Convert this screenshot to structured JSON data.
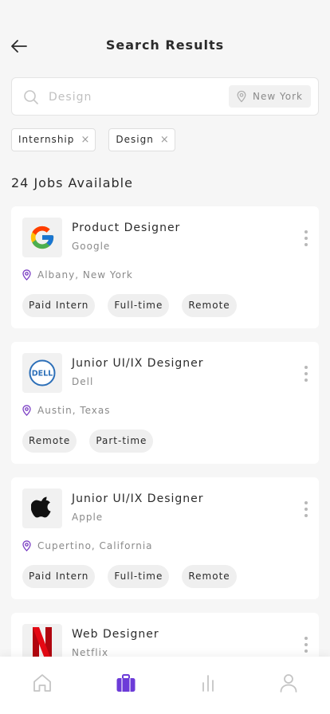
{
  "header": {
    "title": "Search Results"
  },
  "search": {
    "value": "",
    "placeholder": "Design",
    "location": "New York"
  },
  "filters": [
    {
      "label": "Internship"
    },
    {
      "label": "Design"
    }
  ],
  "results": {
    "count_label": "24 Jobs Available"
  },
  "jobs": [
    {
      "title": "Product Designer",
      "company": "Google",
      "location": "Albany, New York",
      "tags": [
        "Paid Intern",
        "Full-time",
        "Remote"
      ],
      "logo_icon": "google-logo-icon"
    },
    {
      "title": "Junior UI/IX Designer",
      "company": "Dell",
      "location": "Austin, Texas",
      "tags": [
        "Remote",
        "Part-time"
      ],
      "logo_icon": "dell-logo-icon",
      "logo_text": "DELL"
    },
    {
      "title": "Junior UI/IX Designer",
      "company": "Apple",
      "location": "Cupertino, California",
      "tags": [
        "Paid Intern",
        "Full-time",
        "Remote"
      ],
      "logo_icon": "apple-logo-icon"
    },
    {
      "title": "Web Designer",
      "company": "Netflix",
      "location": "",
      "tags": [],
      "logo_icon": "netflix-logo-icon"
    }
  ],
  "tabbar": {
    "items": [
      {
        "icon": "home-icon",
        "active": false
      },
      {
        "icon": "briefcase-icon",
        "active": true
      },
      {
        "icon": "stats-icon",
        "active": false
      },
      {
        "icon": "profile-icon",
        "active": false
      }
    ]
  },
  "colors": {
    "accent": "#6c3bd8",
    "text": "#2b2b2b",
    "muted": "#8a8a8a",
    "pin": "#7b3fc4",
    "tab_inactive": "#c4c4c4"
  }
}
